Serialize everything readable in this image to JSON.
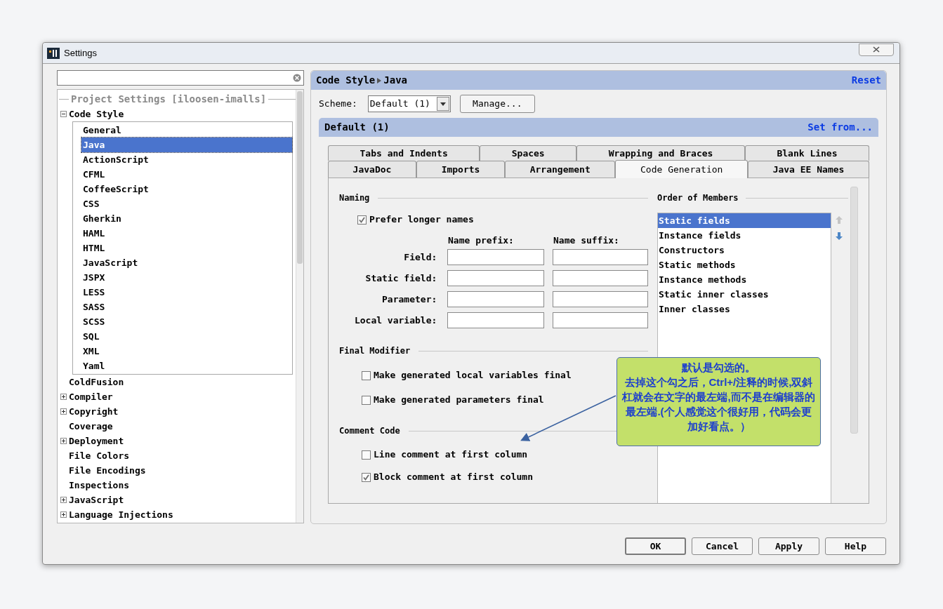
{
  "window": {
    "title": "Settings"
  },
  "sidebar": {
    "section_title": "Project Settings [iloosen-imalls]",
    "tree": [
      {
        "label": "Code Style",
        "expanded": true,
        "children": [
          {
            "label": "General",
            "selected": false
          },
          {
            "label": "Java",
            "selected": true
          },
          {
            "label": "ActionScript",
            "selected": false
          },
          {
            "label": "CFML",
            "selected": false
          },
          {
            "label": "CoffeeScript",
            "selected": false
          },
          {
            "label": "CSS",
            "selected": false
          },
          {
            "label": "Gherkin",
            "selected": false
          },
          {
            "label": "HAML",
            "selected": false
          },
          {
            "label": "HTML",
            "selected": false
          },
          {
            "label": "JavaScript",
            "selected": false
          },
          {
            "label": "JSPX",
            "selected": false
          },
          {
            "label": "LESS",
            "selected": false
          },
          {
            "label": "SASS",
            "selected": false
          },
          {
            "label": "SCSS",
            "selected": false
          },
          {
            "label": "SQL",
            "selected": false
          },
          {
            "label": "XML",
            "selected": false
          },
          {
            "label": "Yaml",
            "selected": false
          }
        ]
      },
      {
        "label": "ColdFusion"
      },
      {
        "label": "Compiler",
        "expanded": false
      },
      {
        "label": "Copyright",
        "expanded": false
      },
      {
        "label": "Coverage"
      },
      {
        "label": "Deployment",
        "expanded": false
      },
      {
        "label": "File Colors"
      },
      {
        "label": "File Encodings"
      },
      {
        "label": "Inspections"
      },
      {
        "label": "JavaScript",
        "expanded": false
      },
      {
        "label": "Language Injections",
        "expanded": false
      }
    ]
  },
  "panel": {
    "breadcrumb": [
      "Code Style",
      "Java"
    ],
    "reset": "Reset",
    "scheme": {
      "label": "Scheme:",
      "value": "Default (1)",
      "manage_button": "Manage..."
    },
    "scheme_header": {
      "title": "Default (1)",
      "link": "Set from..."
    },
    "tab_rows": [
      [
        {
          "label": "Tabs and Indents",
          "selected": false
        },
        {
          "label": "Spaces",
          "selected": false
        },
        {
          "label": "Wrapping and Braces",
          "selected": false
        },
        {
          "label": "Blank Lines",
          "selected": false
        }
      ],
      [
        {
          "label": "JavaDoc",
          "selected": false
        },
        {
          "label": "Imports",
          "selected": false
        },
        {
          "label": "Arrangement",
          "selected": false
        },
        {
          "label": "Code Generation",
          "selected": true
        },
        {
          "label": "Java EE Names",
          "selected": false
        }
      ]
    ],
    "naming": {
      "title": "Naming",
      "prefer_longer": {
        "label": "Prefer longer names",
        "checked": true
      },
      "prefix_header": "Name prefix:",
      "suffix_header": "Name suffix:",
      "rows": [
        {
          "label": "Field:"
        },
        {
          "label": "Static field:"
        },
        {
          "label": "Parameter:"
        },
        {
          "label": "Local variable:"
        }
      ]
    },
    "final_modifier": {
      "title": "Final Modifier",
      "options": [
        {
          "label": "Make generated local variables final",
          "checked": false
        },
        {
          "label": "Make generated parameters final",
          "checked": false
        }
      ]
    },
    "comment_code": {
      "title": "Comment Code",
      "options": [
        {
          "label": "Line comment at first column",
          "checked": false
        },
        {
          "label": "Block comment at first column",
          "checked": true
        }
      ]
    },
    "order_of_members": {
      "title": "Order of Members",
      "items": [
        {
          "label": "Static fields",
          "selected": true
        },
        {
          "label": "Instance fields",
          "selected": false
        },
        {
          "label": "Constructors",
          "selected": false
        },
        {
          "label": "Static methods",
          "selected": false
        },
        {
          "label": "Instance methods",
          "selected": false
        },
        {
          "label": "Static inner classes",
          "selected": false
        },
        {
          "label": "Inner classes",
          "selected": false
        }
      ],
      "move_buttons": [
        {
          "kind": "up",
          "disabled": true
        },
        {
          "kind": "down",
          "disabled": false
        }
      ]
    }
  },
  "buttons": [
    "OK",
    "Cancel",
    "Apply",
    "Help"
  ],
  "callout": {
    "title": "默认是勾选的。",
    "text": "去掉这个勾之后，Ctrl+/注释的时候,双斜杠就会在文字的最左端,而不是在编辑器的最左端.(个人感觉这个很好用，代码会更加好看点。）"
  }
}
